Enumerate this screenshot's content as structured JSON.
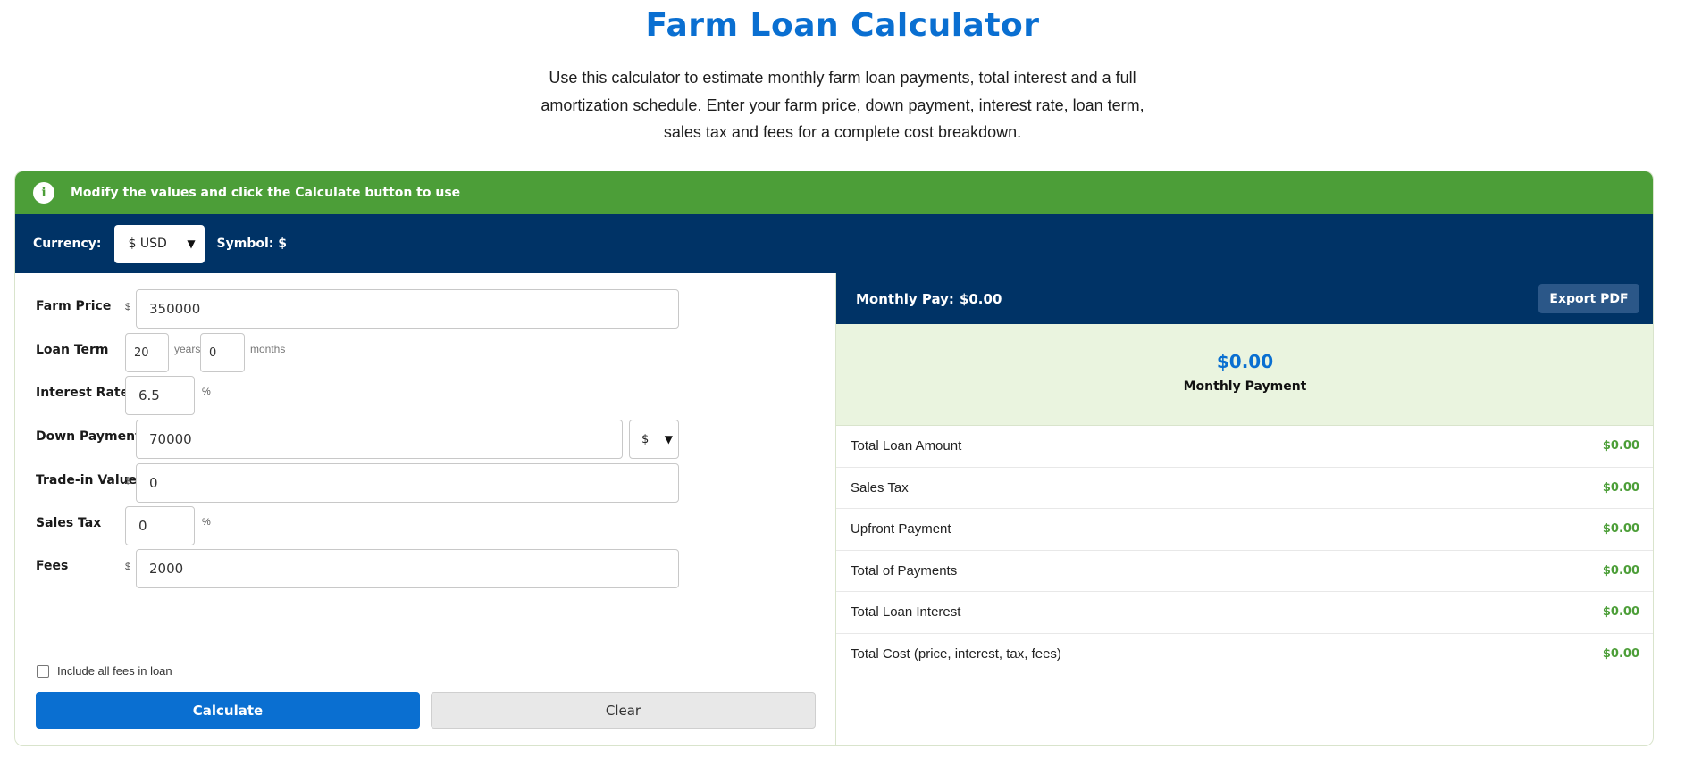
{
  "title": "Farm Loan Calculator",
  "description": "Use this calculator to estimate monthly farm loan payments, total interest and a full amortization schedule. Enter your farm price, down payment, interest rate, loan term, sales tax and fees for a complete cost breakdown.",
  "info_bar": {
    "icon": "info-icon",
    "text": "Modify the values and click the Calculate button to use",
    "color": "#4c9e38"
  },
  "currency_bar": {
    "label": "Currency:",
    "selected": "$ USD",
    "symbol_label": "Symbol: $",
    "color": "#003366"
  },
  "form": {
    "farm_price": {
      "label": "Farm Price",
      "unit": "$",
      "value": "350000"
    },
    "loan_term": {
      "label": "Loan Term",
      "years": "20",
      "years_unit": "years",
      "months": "0",
      "months_unit": "months"
    },
    "interest_rate": {
      "label": "Interest Rate",
      "value": "6.5",
      "unit": "%"
    },
    "down_payment": {
      "label": "Down Payment",
      "value": "70000",
      "unit_select": "$"
    },
    "trade_in": {
      "label": "Trade-in Value",
      "unit": "$",
      "value": "0"
    },
    "sales_tax": {
      "label": "Sales Tax",
      "value": "0",
      "unit": "%"
    },
    "fees": {
      "label": "Fees",
      "unit": "$",
      "value": "2000"
    },
    "include_fees_label": "Include all fees in loan",
    "include_fees_checked": false,
    "calculate_label": "Calculate",
    "clear_label": "Clear"
  },
  "results": {
    "header_label": "Monthly Pay:",
    "header_value": "$0.00",
    "export_label": "Export PDF",
    "summary_amount": "$0.00",
    "summary_label": "Monthly Payment",
    "rows": [
      {
        "label": "Total Loan Amount",
        "value": "$0.00"
      },
      {
        "label": "Sales Tax",
        "value": "$0.00"
      },
      {
        "label": "Upfront Payment",
        "value": "$0.00"
      },
      {
        "label": "Total of Payments",
        "value": "$0.00"
      },
      {
        "label": "Total Loan Interest",
        "value": "$0.00"
      },
      {
        "label": "Total Cost (price, interest, tax, fees)",
        "value": "$0.00"
      }
    ]
  },
  "colors": {
    "accent": "#0a6fd1",
    "success": "#4c9e38",
    "navy": "#003366"
  }
}
